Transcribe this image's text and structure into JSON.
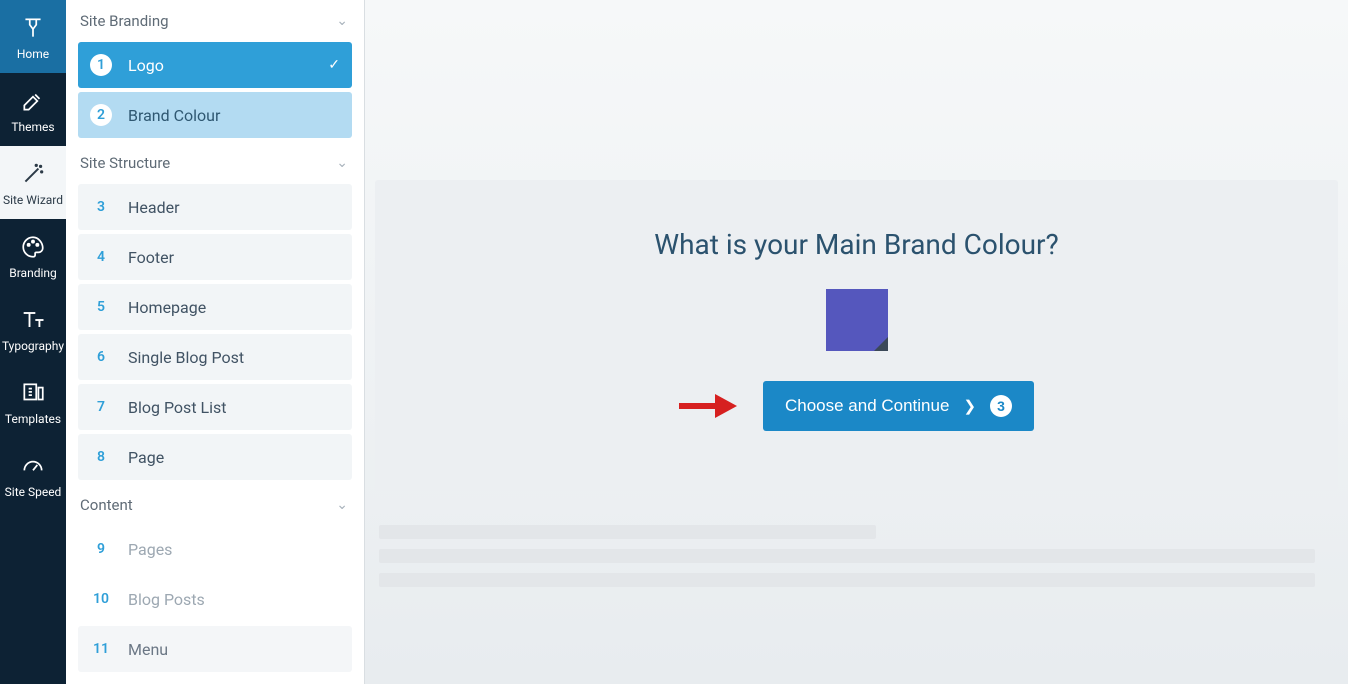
{
  "nav_rail": {
    "items": [
      {
        "label": "Home",
        "icon": "home-icon"
      },
      {
        "label": "Themes",
        "icon": "themes-icon"
      },
      {
        "label": "Site Wizard",
        "icon": "wand-icon"
      },
      {
        "label": "Branding",
        "icon": "palette-icon"
      },
      {
        "label": "Typography",
        "icon": "typography-icon"
      },
      {
        "label": "Templates",
        "icon": "templates-icon"
      },
      {
        "label": "Site Speed",
        "icon": "speed-icon"
      }
    ]
  },
  "sidebar": {
    "sections": [
      {
        "title": "Site Branding",
        "items": [
          {
            "num": "1",
            "label": "Logo",
            "state": "completed"
          },
          {
            "num": "2",
            "label": "Brand Colour",
            "state": "current"
          }
        ]
      },
      {
        "title": "Site Structure",
        "items": [
          {
            "num": "3",
            "label": "Header"
          },
          {
            "num": "4",
            "label": "Footer"
          },
          {
            "num": "5",
            "label": "Homepage"
          },
          {
            "num": "6",
            "label": "Single Blog Post"
          },
          {
            "num": "7",
            "label": "Blog Post List"
          },
          {
            "num": "8",
            "label": "Page"
          }
        ]
      },
      {
        "title": "Content",
        "items": [
          {
            "num": "9",
            "label": "Pages"
          },
          {
            "num": "10",
            "label": "Blog Posts"
          },
          {
            "num": "11",
            "label": "Menu"
          }
        ]
      }
    ]
  },
  "main": {
    "title": "What is your Main Brand Colour?",
    "swatch_color": "#5557bd",
    "cta_label": "Choose and Continue",
    "cta_step": "3"
  }
}
